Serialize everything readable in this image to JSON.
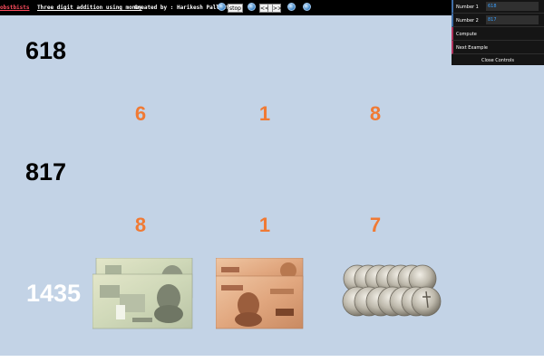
{
  "topbar": {
    "brand": "obstbists",
    "title": "Three digit addition using money",
    "credit": "Created by : Harikesh Pallantla",
    "stop_label": "stop",
    "prev_label": "<<",
    "next_label": ">>"
  },
  "controls": {
    "number1_label": "Number 1",
    "number1_value": "618",
    "number2_label": "Number 2",
    "number2_value": "817",
    "compute_label": "Compute",
    "next_example_label": "Next Example",
    "close_label": "Close Controls"
  },
  "problem": {
    "number1": "618",
    "number2": "817",
    "result": "1435",
    "number1_digits": [
      "6",
      "1",
      "8"
    ],
    "number2_digits": [
      "8",
      "1",
      "7"
    ]
  },
  "colors": {
    "background": "#c3d3e6",
    "digit": "#f07a34",
    "brand": "#ff4d5e",
    "input_value": "#3aa0ff"
  }
}
